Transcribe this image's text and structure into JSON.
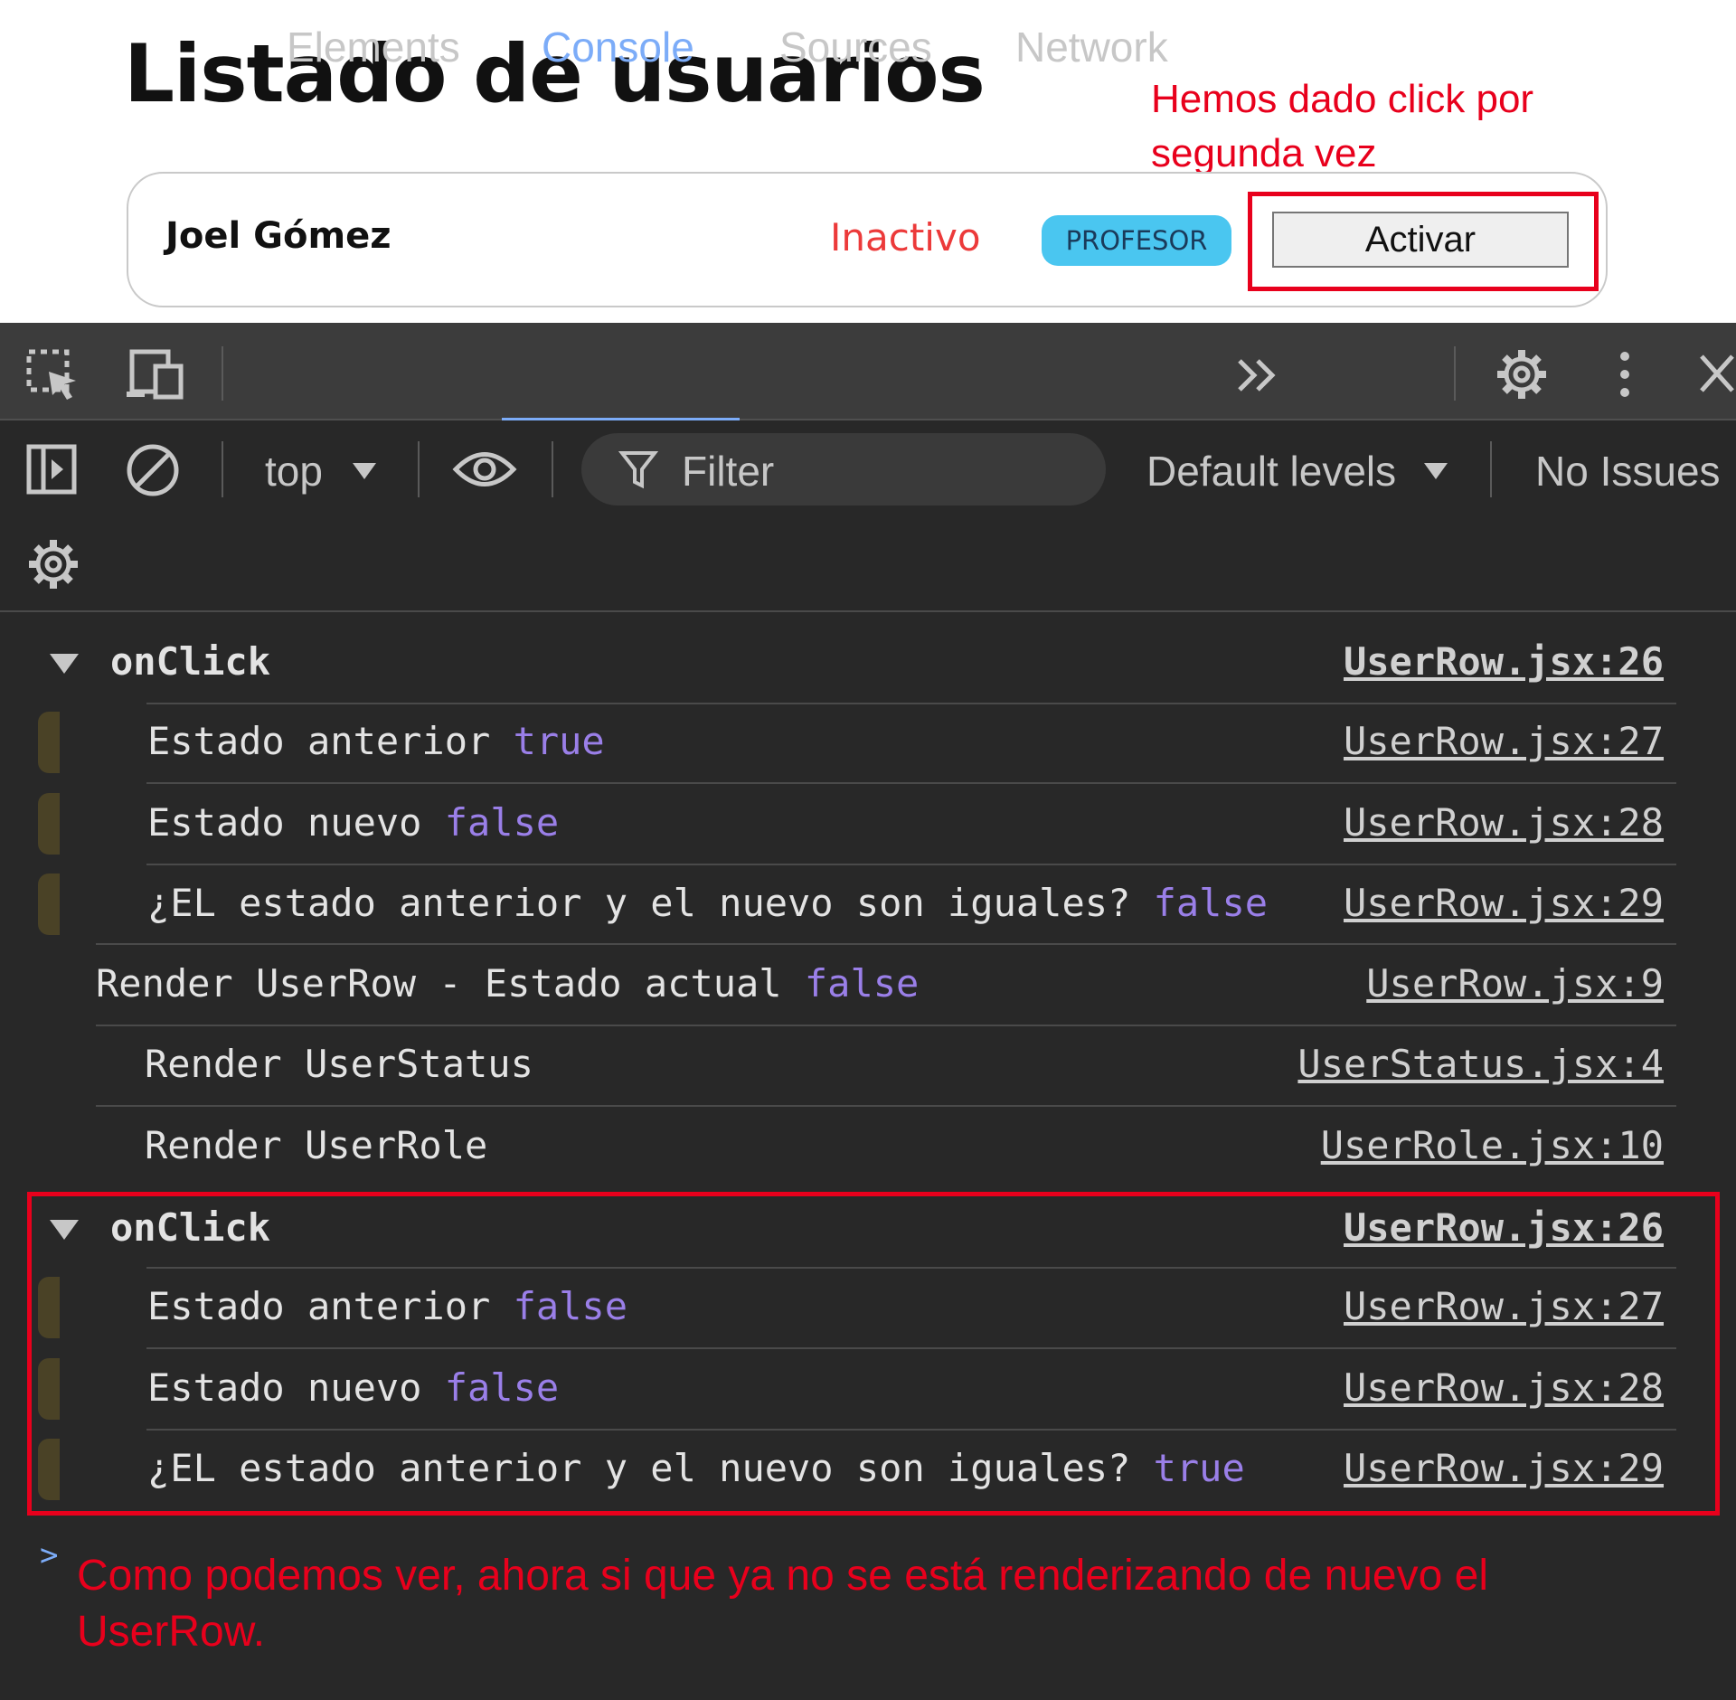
{
  "page": {
    "title": "Listado de usuarios",
    "annotation_top": "Hemos dado click por segunda vez",
    "user": {
      "name": "Joel Gómez",
      "status": "Inactivo",
      "role": "PROFESOR",
      "button": "Activar"
    }
  },
  "devtools": {
    "tabs": [
      "Elements",
      "Console",
      "Sources",
      "Network"
    ],
    "active_tab": "Console",
    "toolbar": {
      "context": "top",
      "filter_placeholder": "Filter",
      "levels": "Default levels",
      "issues": "No Issues"
    }
  },
  "console": {
    "group1": {
      "header": "onClick",
      "header_src": "UserRow.jsx:26",
      "l1_text": "Estado anterior ",
      "l1_val": "true",
      "l1_src": "UserRow.jsx:27",
      "l2_text": "Estado nuevo ",
      "l2_val": "false",
      "l2_src": "UserRow.jsx:28",
      "l3_text": "¿EL estado anterior y el nuevo son iguales? ",
      "l3_val": "false",
      "l3_src": "UserRow.jsx:29"
    },
    "render1_text": "Render UserRow - Estado actual ",
    "render1_val": "false",
    "render1_src": "UserRow.jsx:9",
    "render2_text": "Render UserStatus",
    "render2_src": "UserStatus.jsx:4",
    "render3_text": "Render UserRole",
    "render3_src": "UserRole.jsx:10",
    "group2": {
      "header": "onClick",
      "header_src": "UserRow.jsx:26",
      "l1_text": "Estado anterior ",
      "l1_val": "false",
      "l1_src": "UserRow.jsx:27",
      "l2_text": "Estado nuevo ",
      "l2_val": "false",
      "l2_src": "UserRow.jsx:28",
      "l3_text": "¿EL estado anterior y el nuevo son iguales? ",
      "l3_val": "true",
      "l3_src": "UserRow.jsx:29"
    },
    "prompt": ">",
    "annotation_bottom": "Como podemos ver, ahora si que ya no se está renderizando de nuevo el UserRow."
  }
}
